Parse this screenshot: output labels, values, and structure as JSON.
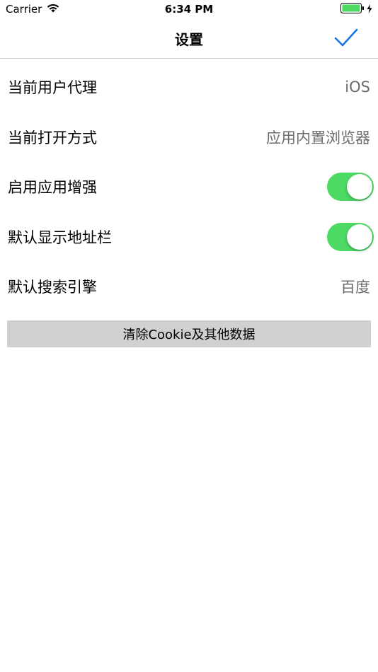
{
  "status_bar": {
    "carrier": "Carrier",
    "time": "6:34 PM"
  },
  "nav": {
    "title": "设置",
    "done_icon": "checkmark-icon"
  },
  "settings": [
    {
      "label": "当前用户代理",
      "value": "iOS"
    },
    {
      "label": "当前打开方式",
      "value": "应用内置浏览器"
    },
    {
      "label": "启用应用增强",
      "toggle": true
    },
    {
      "label": "默认显示地址栏",
      "toggle": true
    },
    {
      "label": "默认搜索引擎",
      "value": "百度"
    }
  ],
  "clear_button": {
    "label": "清除Cookie及其他数据"
  },
  "colors": {
    "accent": "#1a73e8",
    "toggle_on": "#4cd964",
    "battery": "#4cd964",
    "button_bg": "#d0d0d0"
  }
}
